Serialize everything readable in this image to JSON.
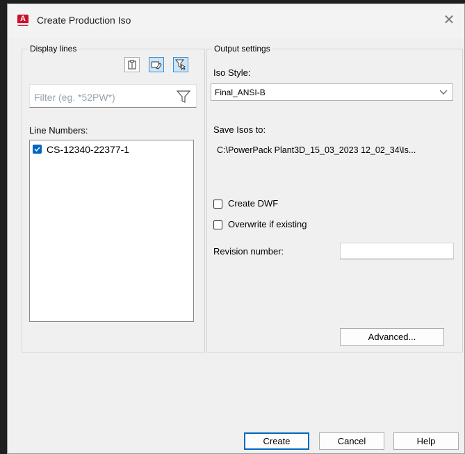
{
  "window": {
    "title": "Create Production Iso",
    "close_glyph": "✕",
    "app_icon_letter": "A"
  },
  "display_lines": {
    "legend": "Display lines",
    "toolbar": [
      {
        "icon": "clipboard-icon",
        "active": false
      },
      {
        "icon": "eraser-icon",
        "active": true
      },
      {
        "icon": "filter-select-icon",
        "active": true
      }
    ],
    "filter_placeholder": "Filter (eg. *52PW*)",
    "line_numbers_label": "Line Numbers:",
    "line_numbers": [
      {
        "label": "CS-12340-22377-1",
        "checked": true
      }
    ]
  },
  "output_settings": {
    "legend": "Output settings",
    "iso_style_label": "Iso Style:",
    "iso_style_value": "Final_ANSI-B",
    "save_isos_label": "Save Isos to:",
    "save_isos_path": "C:\\PowerPack  Plant3D_15_03_2023  12_02_34\\Is...",
    "create_dwf_label": "Create DWF",
    "create_dwf_checked": false,
    "overwrite_label": "Overwrite if existing",
    "overwrite_checked": false,
    "revision_label": "Revision number:",
    "revision_value": "",
    "advanced_label": "Advanced..."
  },
  "footer": {
    "create_label": "Create",
    "cancel_label": "Cancel",
    "help_label": "Help"
  },
  "colors": {
    "accent": "#0067c0",
    "dialog_bg": "#f0f0f0",
    "app_icon": "#c8102e"
  }
}
